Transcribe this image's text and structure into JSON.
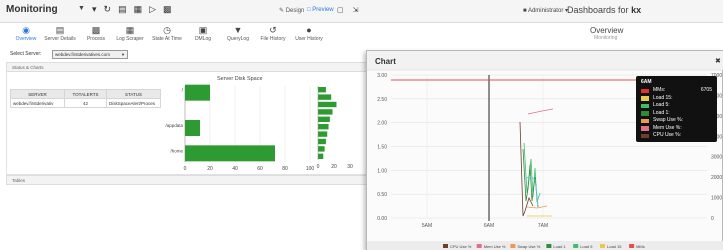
{
  "app": {
    "title": "Monitoring",
    "admin_label": "Administrator ▾",
    "brand": "Dashboards for",
    "brand_mark": "kx",
    "mode_design": "Design",
    "mode_preview": "Preview"
  },
  "toolbar": {
    "items": [
      {
        "label": "Overview",
        "icon": "eye-icon"
      },
      {
        "label": "Server Details",
        "icon": "server-icon"
      },
      {
        "label": "Process",
        "icon": "process-icon"
      },
      {
        "label": "Log Scraper",
        "icon": "log-scraper-icon"
      },
      {
        "label": "State At Time",
        "icon": "clock-icon"
      },
      {
        "label": "DMLog",
        "icon": "document-icon"
      },
      {
        "label": "QueryLog",
        "icon": "filter-icon"
      },
      {
        "label": "File History",
        "icon": "history-icon"
      },
      {
        "label": "User History",
        "icon": "user-icon"
      }
    ]
  },
  "header": {
    "title": "Overview",
    "subtitle": "Monitoring"
  },
  "server_select": {
    "label": "Select Server:",
    "value": "webdev.firstderivatives.com"
  },
  "panels": {
    "status": "Status & Charts",
    "tables": "Tables"
  },
  "alerts_table": {
    "headers": [
      "SERVER",
      "TOTALERTS",
      "STATUS"
    ],
    "rows": [
      [
        "webdev.firstderivativ",
        "42",
        "DiskSpaceAlert/Proces"
      ]
    ]
  },
  "disk_chart": {
    "title": "Server Disk Space",
    "categories": [
      "/",
      "/appdata",
      "/home"
    ],
    "values": [
      20,
      12,
      72
    ],
    "x_ticks": [
      "0",
      "20",
      "40",
      "60",
      "80",
      "100"
    ],
    "xlim": [
      0,
      100
    ],
    "color": "#2e9b32"
  },
  "side_chart": {
    "values": [
      12,
      20,
      28,
      22,
      18,
      16,
      14,
      12,
      10,
      8
    ],
    "x_ticks": [
      "0",
      "20",
      "30"
    ],
    "color": "#2e9b32"
  },
  "popup_chart": {
    "title": "Chart",
    "y_ticks": [
      "3.00",
      "2.50",
      "2.00",
      "1.50",
      "1.00",
      "0.50",
      "0.00"
    ],
    "y2_ticks": [
      "7000",
      "6000",
      "5000",
      "4000",
      "3000",
      "2000",
      "1000",
      "0"
    ],
    "x_ticks": [
      "5AM",
      "6AM",
      "7AM"
    ],
    "legend": [
      {
        "label": "CPU Use %",
        "color": "#6b3f2a"
      },
      {
        "label": "Mem Use %",
        "color": "#e0708a"
      },
      {
        "label": "Swap Use %",
        "color": "#e89a55"
      },
      {
        "label": "Load 1",
        "color": "#2f8a3c"
      },
      {
        "label": "Load 5",
        "color": "#3bbf6a"
      },
      {
        "label": "Load 15",
        "color": "#e9c84a"
      },
      {
        "label": "MMs",
        "color": "#e05050"
      }
    ]
  },
  "tooltip": {
    "header": "6AM",
    "rows": [
      {
        "label": "MMs:",
        "value": "6705",
        "color": "#e03030"
      },
      {
        "label": "Load 15:",
        "value": "",
        "color": "#e9c84a"
      },
      {
        "label": "Load 5:",
        "value": "",
        "color": "#3bbf6a"
      },
      {
        "label": "Load 1:",
        "value": "",
        "color": "#2f8a3c"
      },
      {
        "label": "Swap Use %:",
        "value": "",
        "color": "#e89a55"
      },
      {
        "label": "Mem Use %:",
        "value": "",
        "color": "#e0708a"
      },
      {
        "label": "CPU Use %:",
        "value": "",
        "color": "#6b3f2a"
      }
    ]
  }
}
